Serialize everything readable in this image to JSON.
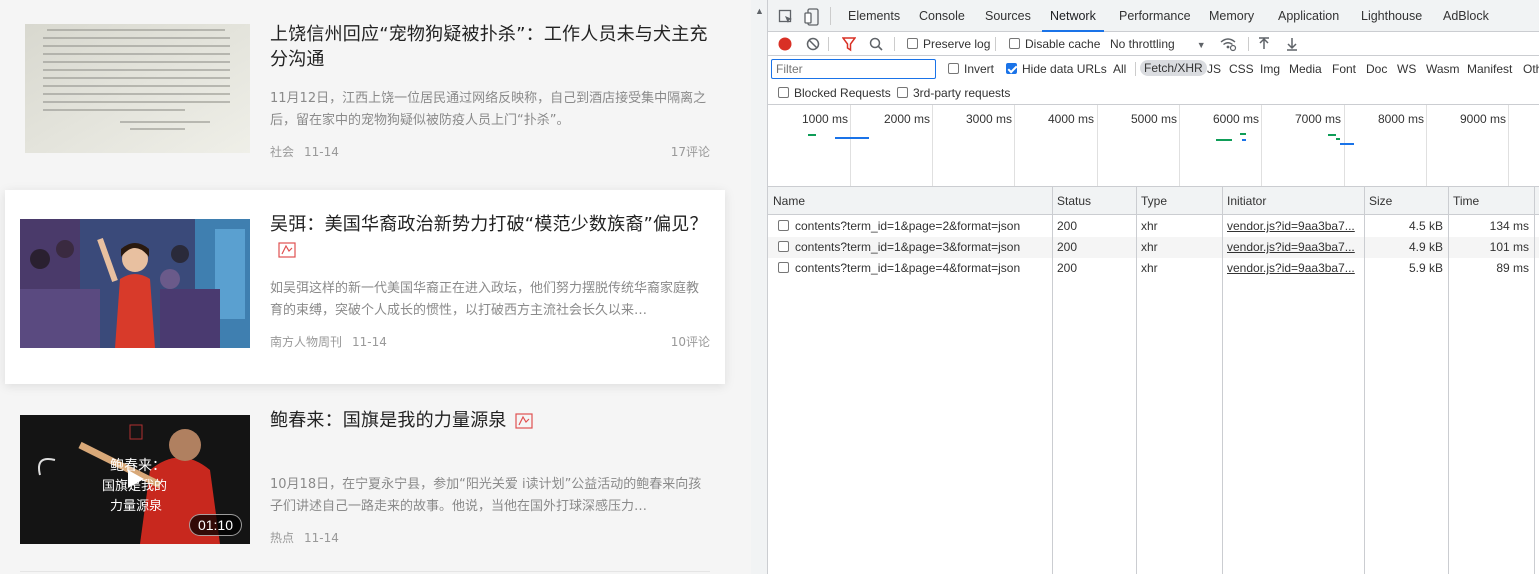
{
  "feed": {
    "articles": [
      {
        "title": "上饶信州回应“宠物狗疑被扑杀”：工作人员未与犬主充分沟通",
        "summary": "11月12日，江西上饶一位居民通过网络反映称，自己到酒店接受集中隔离之后，留在家中的宠物狗疑似被防疫人员上门“扑杀”。",
        "source": "社会",
        "date": "11-14",
        "comments": "17评论",
        "thumb_icon": "document-photo-thumbnail"
      },
      {
        "title": "吴弭：美国华裔政治新势力打破“模范少数族裔”偏见？",
        "summary": "如吴弭这样的新一代美国华裔正在进入政坛，他们努力摆脱传统华裔家庭教育的束缚，突破个人成长的惯性，以打破西方主流社会长久以来…",
        "source": "南方人物周刊",
        "date": "11-14",
        "comments": "10评论",
        "thumb_icon": "rally-photo-thumbnail"
      },
      {
        "title": "鲍春来：国旗是我的力量源泉",
        "summary": "10月18日，在宁夏永宁县，参加“阳光关爱 i读计划”公益活动的鲍春来向孩子们讲述自己一路走来的故事。他说，当他在国外打球深感压力…",
        "source": "热点",
        "date": "11-14",
        "comments": "",
        "duration": "01:10",
        "thumb_icon": "badminton-video-thumbnail"
      }
    ]
  },
  "devtools": {
    "tabs": [
      "Elements",
      "Console",
      "Sources",
      "Network",
      "Performance",
      "Memory",
      "Application",
      "Lighthouse",
      "AdBlock"
    ],
    "active_tab": "Network",
    "toolbar": {
      "preserve_log": "Preserve log",
      "disable_cache": "Disable cache",
      "throttling": "No throttling"
    },
    "filter": {
      "placeholder": "Filter",
      "invert": "Invert",
      "hide_data_urls": "Hide data URLs",
      "types": [
        "All",
        "Fetch/XHR",
        "JS",
        "CSS",
        "Img",
        "Media",
        "Font",
        "Doc",
        "WS",
        "Wasm",
        "Manifest",
        "Oth"
      ],
      "active_type": "Fetch/XHR",
      "blocked_requests": "Blocked Requests",
      "third_party": "3rd-party requests"
    },
    "timeline": {
      "labels": [
        "1000 ms",
        "2000 ms",
        "3000 ms",
        "4000 ms",
        "5000 ms",
        "6000 ms",
        "7000 ms",
        "8000 ms",
        "9000 ms"
      ]
    },
    "table": {
      "columns": [
        "Name",
        "Status",
        "Type",
        "Initiator",
        "Size",
        "Time"
      ],
      "rows": [
        {
          "name": "contents?term_id=1&page=2&format=json",
          "status": "200",
          "type": "xhr",
          "initiator": "vendor.js?id=9aa3ba7...",
          "size": "4.5 kB",
          "time": "134 ms"
        },
        {
          "name": "contents?term_id=1&page=3&format=json",
          "status": "200",
          "type": "xhr",
          "initiator": "vendor.js?id=9aa3ba7...",
          "size": "4.9 kB",
          "time": "101 ms"
        },
        {
          "name": "contents?term_id=1&page=4&format=json",
          "status": "200",
          "type": "xhr",
          "initiator": "vendor.js?id=9aa3ba7...",
          "size": "5.9 kB",
          "time": "89 ms"
        }
      ]
    }
  }
}
